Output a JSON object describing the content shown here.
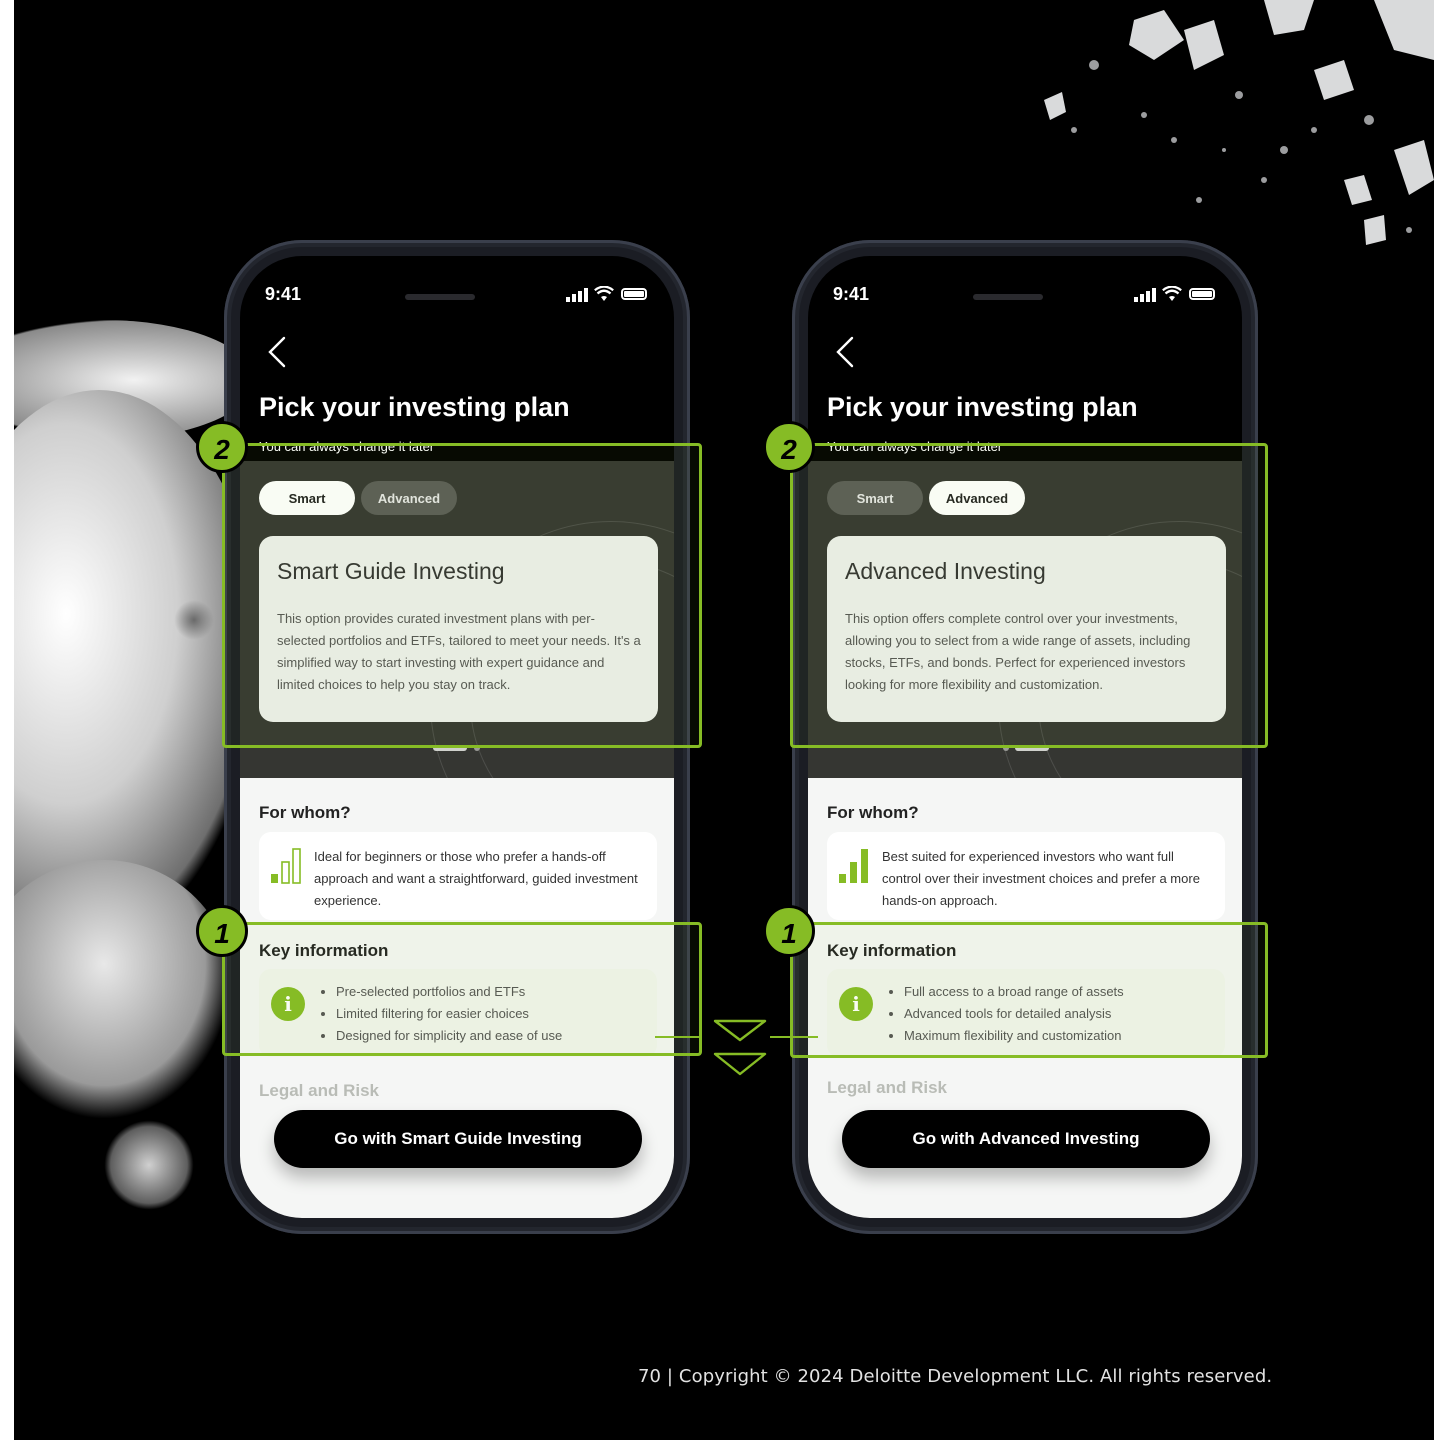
{
  "colors": {
    "accent": "#86bc25",
    "background": "#000000"
  },
  "phones": [
    {
      "status_time": "9:41",
      "title": "Pick your investing plan",
      "subtitle": "You can always change it later",
      "tabs": [
        "Smart",
        "Advanced"
      ],
      "active_tab": "Smart",
      "card_title": "Smart Guide Investing",
      "card_body": "This option provides curated investment plans with per-selected portfolios and ETFs, tailored to meet your needs. It's a simplified way to start investing with expert guidance and limited choices to help you stay on track.",
      "carousel_page": 1,
      "for_whom_title": "For whom?",
      "for_whom_text": "Ideal for beginners or those who prefer a hands-off approach and want a straightforward, guided investment experience.",
      "for_whom_icon": "bar-level-low-icon",
      "key_info_title": "Key information",
      "key_info": [
        "Pre-selected portfolios and ETFs",
        "Limited filtering for easier choices",
        "Designed for simplicity and ease of use"
      ],
      "legal_title": "Legal and Risk",
      "cta": "Go with Smart Guide Investing"
    },
    {
      "status_time": "9:41",
      "title": "Pick your investing plan",
      "subtitle": "You can always change it later",
      "tabs": [
        "Smart",
        "Advanced"
      ],
      "active_tab": "Advanced",
      "card_title": "Advanced Investing",
      "card_body": "This option offers complete control over your investments, allowing you to select from a wide range of assets, including stocks, ETFs, and bonds. Perfect for experienced investors looking for more flexibility and customization.",
      "carousel_page": 2,
      "for_whom_title": "For whom?",
      "for_whom_text": "Best suited for experienced investors who want full control over their investment choices and prefer a more hands-on approach.",
      "for_whom_icon": "bar-level-high-icon",
      "key_info_title": "Key information",
      "key_info": [
        "Full access to a broad range of assets",
        "Advanced tools for detailed analysis",
        "Maximum flexibility and customization"
      ],
      "legal_title": "Legal and Risk",
      "cta": "Go with Advanced Investing"
    }
  ],
  "annotations": {
    "badge_hero": "2",
    "badge_key_info": "1"
  },
  "footer": "70 | Copyright © 2024 Deloitte Development LLC. All rights reserved."
}
